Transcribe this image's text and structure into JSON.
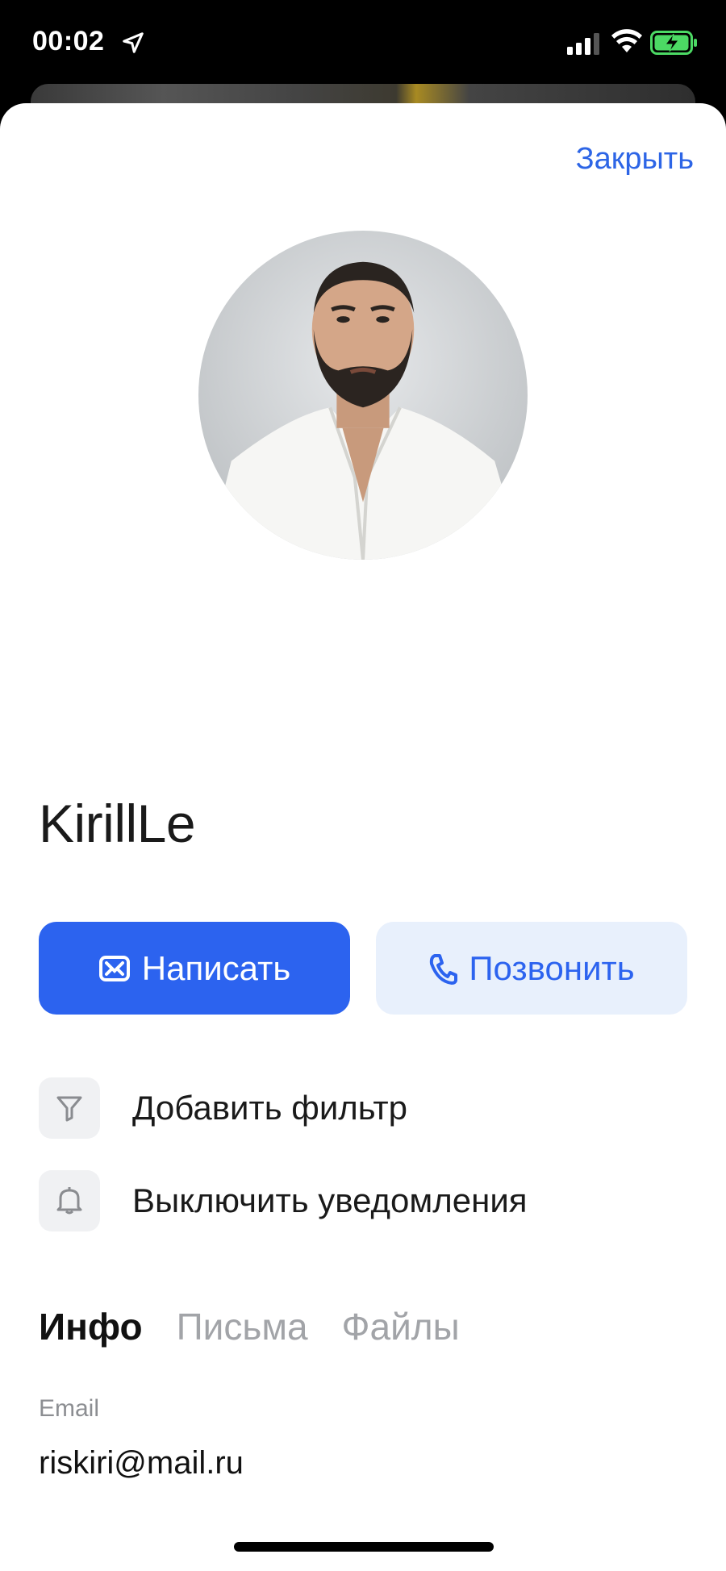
{
  "status_bar": {
    "time": "00:02",
    "icons": [
      "location-arrow-icon",
      "cellular-signal-icon",
      "wifi-icon",
      "battery-charging-icon"
    ]
  },
  "sheet": {
    "close_label": "Закрыть"
  },
  "contact": {
    "name": "KirillLe",
    "avatar": "profile-photo"
  },
  "actions": {
    "write_label": "Написать",
    "call_label": "Позвонить",
    "filter_label": "Добавить фильтр",
    "notify_label": "Выключить уведомления"
  },
  "tabs": [
    {
      "label": "Инфо",
      "active": true
    },
    {
      "label": "Письма",
      "active": false
    },
    {
      "label": "Файлы",
      "active": false
    }
  ],
  "info": {
    "email_label": "Email",
    "email_value": "riskiri@mail.ru"
  },
  "colors": {
    "accent": "#2c63ef",
    "accent_light": "#e8f0fc",
    "link": "#2d65e6"
  }
}
